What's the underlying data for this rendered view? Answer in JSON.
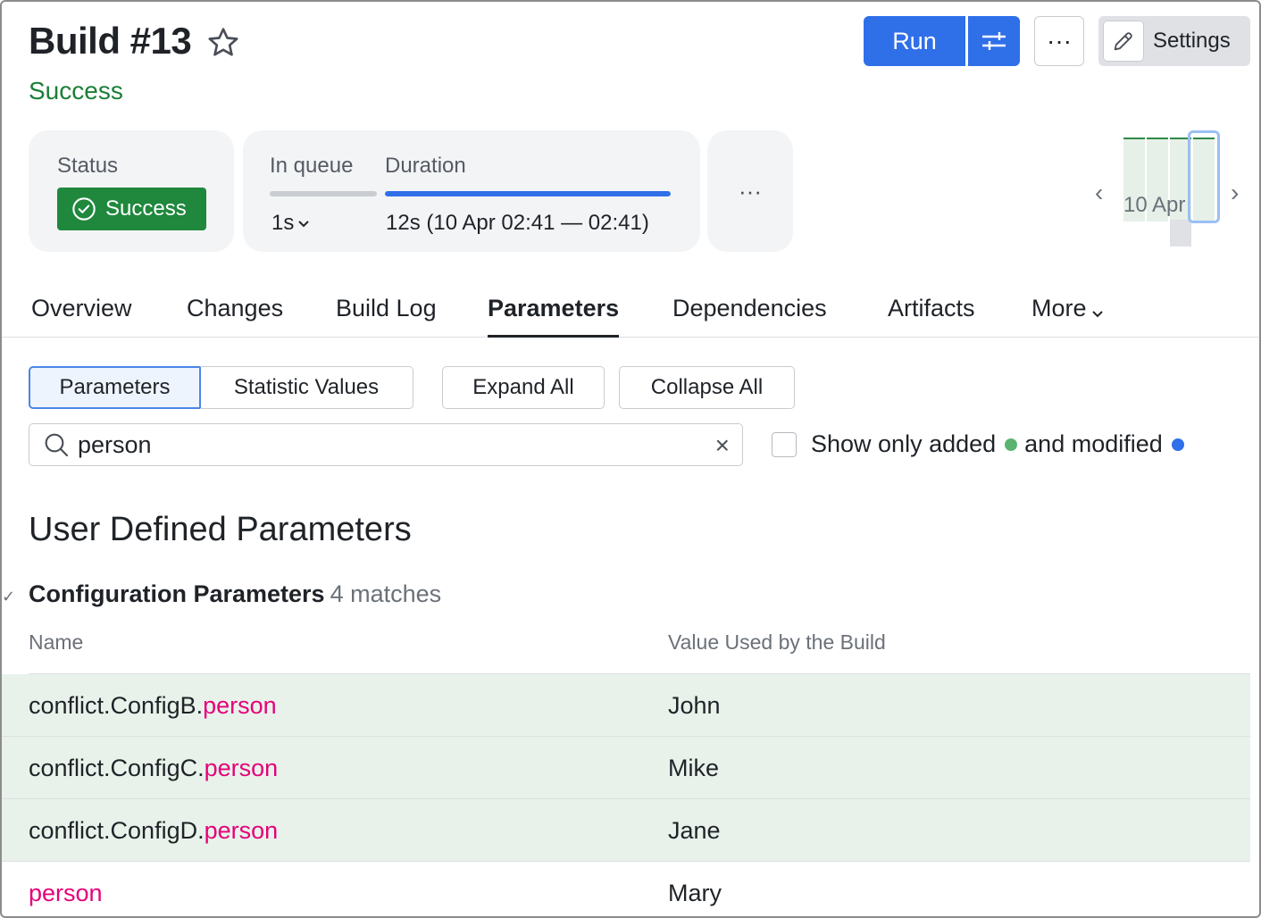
{
  "header": {
    "title": "Build #13",
    "status_text": "Success",
    "run_label": "Run",
    "more_label": "···",
    "settings_label": "Settings"
  },
  "summary": {
    "status_label": "Status",
    "status_badge": "Success",
    "queue_label": "In queue",
    "queue_value": "1s",
    "duration_label": "Duration",
    "duration_value": "12s (10 Apr 02:41 — 02:41)",
    "duration_progress": 1.0,
    "more_label": "···"
  },
  "history": {
    "date_label": "10 Apr",
    "prev": "‹",
    "next": "›"
  },
  "tabs": [
    {
      "label": "Overview"
    },
    {
      "label": "Changes"
    },
    {
      "label": "Build Log"
    },
    {
      "label": "Parameters",
      "active": true
    },
    {
      "label": "Dependencies"
    },
    {
      "label": "Artifacts"
    },
    {
      "label": "More"
    }
  ],
  "toolbar": {
    "seg_parameters": "Parameters",
    "seg_statistics": "Statistic Values",
    "expand_all": "Expand All",
    "collapse_all": "Collapse All"
  },
  "search": {
    "value": "person",
    "clear": "×"
  },
  "filter": {
    "label_part1": "Show only added",
    "label_part2": "and modified",
    "added_color": "#5cb270",
    "modified_color": "#2f6fe8"
  },
  "section": {
    "title": "User Defined Parameters",
    "group_title": "Configuration Parameters",
    "group_count": "4 matches",
    "col_name": "Name",
    "col_value": "Value Used by the Build"
  },
  "rows": [
    {
      "prefix": "conflict.ConfigB.",
      "match": "person",
      "value": "John",
      "modified": true
    },
    {
      "prefix": "conflict.ConfigC.",
      "match": "person",
      "value": "Mike",
      "modified": true
    },
    {
      "prefix": "conflict.ConfigD.",
      "match": "person",
      "value": "Jane",
      "modified": true
    },
    {
      "prefix": "",
      "match": "person",
      "value": "Mary",
      "modified": false
    }
  ],
  "colors": {
    "accent": "#2f6fe8",
    "success": "#1f883d",
    "highlight": "#e5007a",
    "modified_row": "#e8f2ea"
  }
}
